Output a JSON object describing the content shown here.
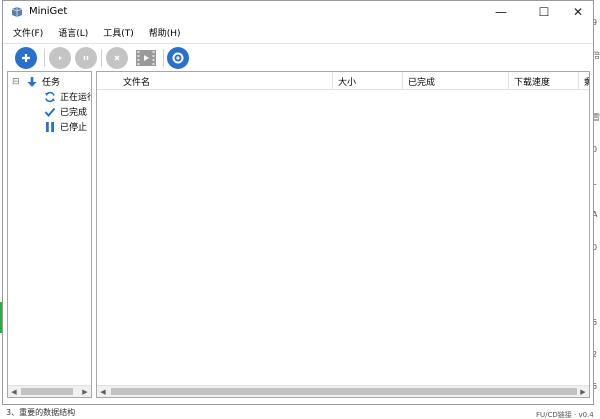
{
  "window": {
    "title": "MiniGet"
  },
  "window_controls": {
    "minimize": "—",
    "maximize": "☐",
    "close": "✕"
  },
  "menu": [
    {
      "label": "文件(F)"
    },
    {
      "label": "语言(L)"
    },
    {
      "label": "工具(T)"
    },
    {
      "label": "帮助(H)"
    }
  ],
  "toolbar": [
    {
      "icon": "add-icon",
      "color": "#2b6fc8"
    },
    {
      "icon": "play-icon",
      "color": "#c4c4c4"
    },
    {
      "icon": "pause-icon",
      "color": "#c4c4c4"
    },
    {
      "icon": "delete-icon",
      "color": "#c4c4c4"
    },
    {
      "icon": "preview-icon",
      "color": "#8a8a8a"
    },
    {
      "icon": "settings-icon",
      "color": "#2b6fc8"
    }
  ],
  "tree": {
    "root": {
      "expander": "⊟",
      "label": "任务"
    },
    "children": [
      {
        "label": "正在运行",
        "icon": "refresh-icon"
      },
      {
        "label": "已完成",
        "icon": "check-icon"
      },
      {
        "label": "已停止",
        "icon": "pause-icon"
      }
    ]
  },
  "columns": [
    {
      "label": "文件名"
    },
    {
      "label": "大小"
    },
    {
      "label": "已完成"
    },
    {
      "label": "下载速度"
    },
    {
      "label": "剩余"
    }
  ],
  "background": {
    "right_edge_glyphs": [
      "9",
      "倍",
      "雪",
      "0",
      "L",
      "A",
      "0",
      "6",
      "2",
      "6"
    ],
    "under_text": "3、重要的数据结构",
    "under_right": "FU/CD链接 · v0.4"
  },
  "colors": {
    "accent": "#2b6fc8",
    "disabled": "#c4c4c4"
  }
}
